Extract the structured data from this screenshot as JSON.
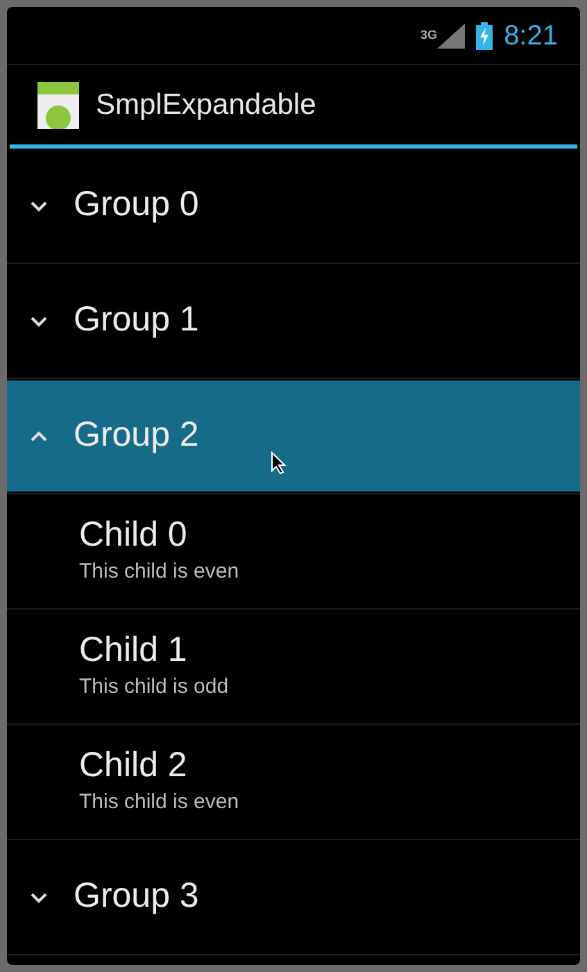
{
  "status_bar": {
    "network": "3G",
    "time": "8:21"
  },
  "action_bar": {
    "title": "SmplExpandable"
  },
  "groups": [
    {
      "label": "Group 0",
      "expanded": false,
      "selected": false
    },
    {
      "label": "Group 1",
      "expanded": false,
      "selected": false
    },
    {
      "label": "Group 2",
      "expanded": true,
      "selected": true,
      "children": [
        {
          "title": "Child 0",
          "subtitle": "This child is even"
        },
        {
          "title": "Child 1",
          "subtitle": "This child is odd"
        },
        {
          "title": "Child 2",
          "subtitle": "This child is even"
        }
      ]
    },
    {
      "label": "Group 3",
      "expanded": false,
      "selected": false
    }
  ]
}
